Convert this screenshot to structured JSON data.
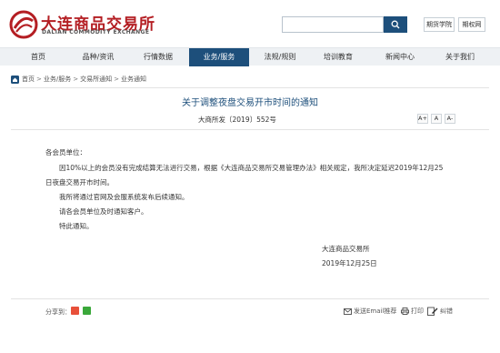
{
  "header": {
    "logo_cn": "大连商品交易所",
    "logo_en": "DALIAN COMMODITY EXCHANGE",
    "search_placeholder": "",
    "links": [
      "期货学院",
      "期权网"
    ]
  },
  "nav": {
    "items": [
      "首页",
      "品种/资讯",
      "行情数据",
      "业务/服务",
      "法规/规则",
      "培训教育",
      "新闻中心",
      "关于我们"
    ],
    "active": "业务/服务"
  },
  "breadcrumb": [
    "首页",
    "业务/服务",
    "交易所通知",
    "业务通知"
  ],
  "article": {
    "title": "关于调整夜盘交易开市时间的通知",
    "doc_number": "大商所发〔2019〕552号",
    "font_sizes": [
      "A+",
      "A",
      "A-"
    ],
    "salutation": "各会员单位：",
    "paragraphs": [
      "因10%以上的会员没有完成结算无法进行交易，根据《大连商品交易所交易管理办法》相关规定，我所决定延迟2019年12月25",
      "日夜盘交易开市时间。",
      "我所将通过官网及会服系统发布后续通知。",
      "请各会员单位及时通知客户。",
      "特此通知。"
    ],
    "signature": "大连商品交易所",
    "date": "2019年12月25日"
  },
  "footer": {
    "share_label": "分享到：",
    "tools": [
      "发送Email推荐",
      "打印",
      "纠错"
    ]
  },
  "colors": {
    "brand_red": "#b41e23",
    "brand_blue": "#1d4f7b",
    "nav_bg": "#eef1f4"
  }
}
